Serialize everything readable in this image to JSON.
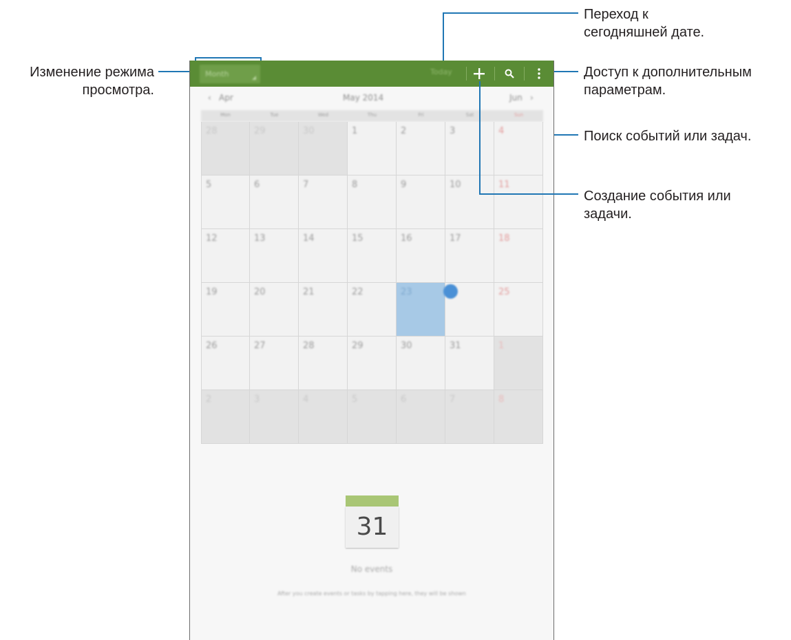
{
  "callouts": {
    "view_mode": [
      "Изменение режима",
      "просмотра."
    ],
    "today": [
      "Переход к",
      "сегодняшней дате."
    ],
    "more": [
      "Доступ к дополнительным",
      "параметрам."
    ],
    "search": "Поиск событий или задач.",
    "create": [
      "Создание события или",
      "задачи."
    ]
  },
  "actionbar": {
    "view_mode_label": "Month",
    "today_label": "Today",
    "icons": [
      "add-icon",
      "search-icon",
      "more-options-icon"
    ]
  },
  "month_nav": {
    "prev_label": "Apr",
    "title": "May 2014",
    "next_label": "Jun"
  },
  "weekdays": [
    "Mon",
    "Tue",
    "Wed",
    "Thu",
    "Fri",
    "Sat",
    "Sun"
  ],
  "calendar": {
    "weeks": [
      [
        "28",
        "29",
        "30",
        "1",
        "2",
        "3",
        "4"
      ],
      [
        "5",
        "6",
        "7",
        "8",
        "9",
        "10",
        "11"
      ],
      [
        "12",
        "13",
        "14",
        "15",
        "16",
        "17",
        "18"
      ],
      [
        "19",
        "20",
        "21",
        "22",
        "23",
        "24",
        "25"
      ],
      [
        "26",
        "27",
        "28",
        "29",
        "30",
        "31",
        "1"
      ],
      [
        "2",
        "3",
        "4",
        "5",
        "6",
        "7",
        "8"
      ]
    ],
    "selected_day": "23",
    "today_day": "24"
  },
  "empty_state": {
    "icon_number": "31",
    "title": "No events",
    "hint": "After you create events or tasks by tapping here, they will be shown"
  },
  "colors": {
    "actionbar": "#5a8c35",
    "callout_line": "#1f76b4",
    "selected": "#a7c9e6",
    "today_dot": "#4a90d6",
    "sunday": "#e39b9b"
  }
}
